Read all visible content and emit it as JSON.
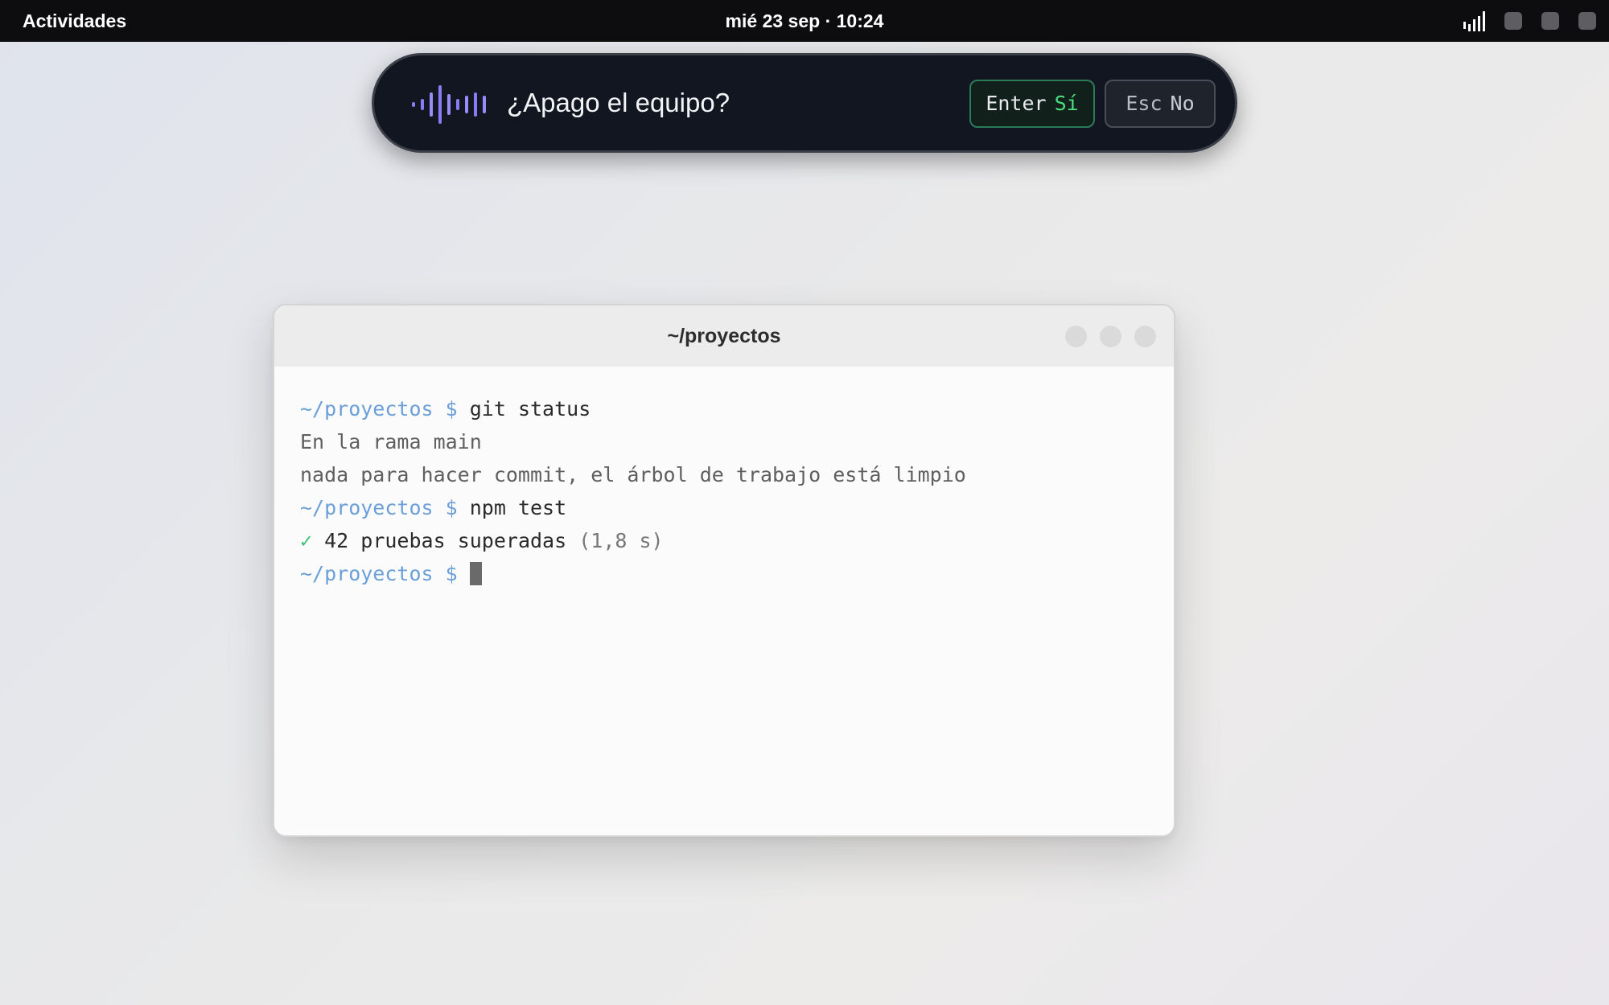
{
  "topbar": {
    "activities_label": "Actividades",
    "clock": "mié 23 sep · 10:24",
    "tray_icons": [
      "signal-icon",
      "tray-indicator-icon",
      "tray-indicator-icon",
      "tray-indicator-icon"
    ]
  },
  "voice_prompt": {
    "icon": "voice-wave-icon",
    "accent_color": "#8b7cf6",
    "question": "¿Apago el equipo?",
    "confirm": {
      "key": "Enter",
      "label": "Sí",
      "color": "#4ade80"
    },
    "cancel": {
      "key": "Esc",
      "label": "No"
    }
  },
  "terminal": {
    "title": "~/proyectos",
    "prompt_color": "#6b9fd8",
    "lines": [
      {
        "prompt": "~/proyectos $",
        "command": "git status"
      },
      {
        "output": "En la rama main"
      },
      {
        "output": "nada para hacer commit, el árbol de trabajo está limpio"
      },
      {
        "prompt": "~/proyectos $",
        "command": "npm test"
      },
      {
        "check": "✓",
        "text": "42 pruebas superadas",
        "detail": "(1,8 s)"
      },
      {
        "prompt": "~/proyectos $",
        "command": ""
      }
    ]
  }
}
